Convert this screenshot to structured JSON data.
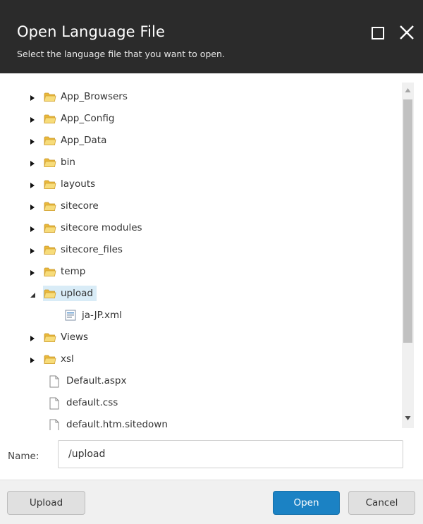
{
  "dialog": {
    "title": "Open Language File",
    "subtitle": "Select the language file that you want to open.",
    "controls": {
      "maximize_icon": "maximize-icon",
      "close_icon": "close-icon"
    }
  },
  "tree": {
    "items": [
      {
        "label": "App_Browsers",
        "type": "folder",
        "state": "collapsed"
      },
      {
        "label": "App_Config",
        "type": "folder",
        "state": "collapsed"
      },
      {
        "label": "App_Data",
        "type": "folder",
        "state": "collapsed"
      },
      {
        "label": "bin",
        "type": "folder",
        "state": "collapsed"
      },
      {
        "label": "layouts",
        "type": "folder",
        "state": "collapsed"
      },
      {
        "label": "sitecore",
        "type": "folder",
        "state": "collapsed"
      },
      {
        "label": "sitecore modules",
        "type": "folder",
        "state": "collapsed"
      },
      {
        "label": "sitecore_files",
        "type": "folder",
        "state": "collapsed"
      },
      {
        "label": "temp",
        "type": "folder",
        "state": "collapsed"
      },
      {
        "label": "upload",
        "type": "folder",
        "state": "expanded",
        "selected": true
      },
      {
        "label": "ja-JP.xml",
        "type": "xml-file"
      },
      {
        "label": "Views",
        "type": "folder",
        "state": "collapsed"
      },
      {
        "label": "xsl",
        "type": "folder",
        "state": "collapsed"
      },
      {
        "label": "Default.aspx",
        "type": "file"
      },
      {
        "label": "default.css",
        "type": "file"
      },
      {
        "label": "default.htm.sitedown",
        "type": "file"
      }
    ]
  },
  "name_field": {
    "label": "Name:",
    "value": "/upload"
  },
  "buttons": {
    "upload": "Upload",
    "open": "Open",
    "cancel": "Cancel"
  },
  "colors": {
    "header_bg": "#2b2b2b",
    "primary_button": "#1b82c4",
    "selection_bg": "#d9ecf7",
    "folder_yellow": "#f5d56b"
  }
}
